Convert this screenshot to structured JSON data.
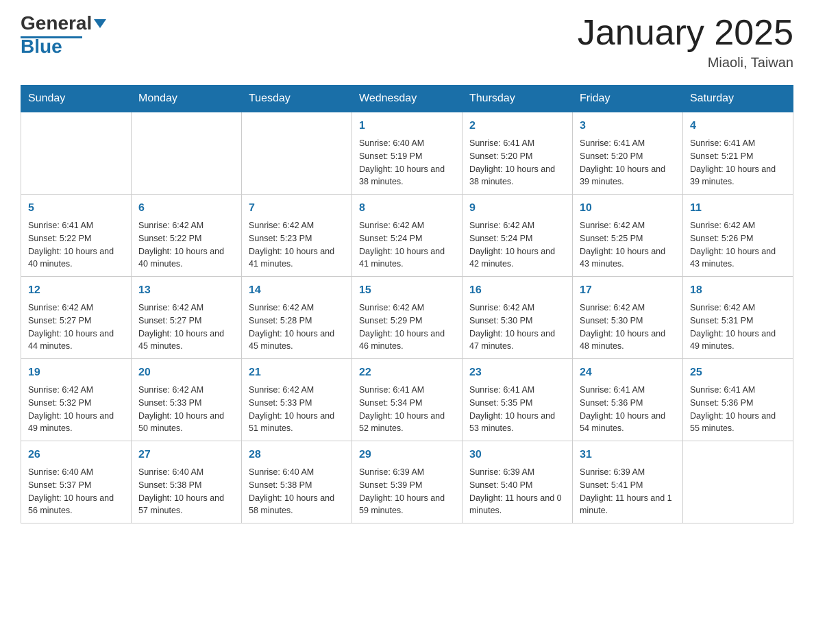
{
  "header": {
    "logo_general": "General",
    "logo_blue": "Blue",
    "month_title": "January 2025",
    "location": "Miaoli, Taiwan"
  },
  "days_of_week": [
    "Sunday",
    "Monday",
    "Tuesday",
    "Wednesday",
    "Thursday",
    "Friday",
    "Saturday"
  ],
  "weeks": [
    [
      {
        "day": "",
        "info": ""
      },
      {
        "day": "",
        "info": ""
      },
      {
        "day": "",
        "info": ""
      },
      {
        "day": "1",
        "info": "Sunrise: 6:40 AM\nSunset: 5:19 PM\nDaylight: 10 hours\nand 38 minutes."
      },
      {
        "day": "2",
        "info": "Sunrise: 6:41 AM\nSunset: 5:20 PM\nDaylight: 10 hours\nand 38 minutes."
      },
      {
        "day": "3",
        "info": "Sunrise: 6:41 AM\nSunset: 5:20 PM\nDaylight: 10 hours\nand 39 minutes."
      },
      {
        "day": "4",
        "info": "Sunrise: 6:41 AM\nSunset: 5:21 PM\nDaylight: 10 hours\nand 39 minutes."
      }
    ],
    [
      {
        "day": "5",
        "info": "Sunrise: 6:41 AM\nSunset: 5:22 PM\nDaylight: 10 hours\nand 40 minutes."
      },
      {
        "day": "6",
        "info": "Sunrise: 6:42 AM\nSunset: 5:22 PM\nDaylight: 10 hours\nand 40 minutes."
      },
      {
        "day": "7",
        "info": "Sunrise: 6:42 AM\nSunset: 5:23 PM\nDaylight: 10 hours\nand 41 minutes."
      },
      {
        "day": "8",
        "info": "Sunrise: 6:42 AM\nSunset: 5:24 PM\nDaylight: 10 hours\nand 41 minutes."
      },
      {
        "day": "9",
        "info": "Sunrise: 6:42 AM\nSunset: 5:24 PM\nDaylight: 10 hours\nand 42 minutes."
      },
      {
        "day": "10",
        "info": "Sunrise: 6:42 AM\nSunset: 5:25 PM\nDaylight: 10 hours\nand 43 minutes."
      },
      {
        "day": "11",
        "info": "Sunrise: 6:42 AM\nSunset: 5:26 PM\nDaylight: 10 hours\nand 43 minutes."
      }
    ],
    [
      {
        "day": "12",
        "info": "Sunrise: 6:42 AM\nSunset: 5:27 PM\nDaylight: 10 hours\nand 44 minutes."
      },
      {
        "day": "13",
        "info": "Sunrise: 6:42 AM\nSunset: 5:27 PM\nDaylight: 10 hours\nand 45 minutes."
      },
      {
        "day": "14",
        "info": "Sunrise: 6:42 AM\nSunset: 5:28 PM\nDaylight: 10 hours\nand 45 minutes."
      },
      {
        "day": "15",
        "info": "Sunrise: 6:42 AM\nSunset: 5:29 PM\nDaylight: 10 hours\nand 46 minutes."
      },
      {
        "day": "16",
        "info": "Sunrise: 6:42 AM\nSunset: 5:30 PM\nDaylight: 10 hours\nand 47 minutes."
      },
      {
        "day": "17",
        "info": "Sunrise: 6:42 AM\nSunset: 5:30 PM\nDaylight: 10 hours\nand 48 minutes."
      },
      {
        "day": "18",
        "info": "Sunrise: 6:42 AM\nSunset: 5:31 PM\nDaylight: 10 hours\nand 49 minutes."
      }
    ],
    [
      {
        "day": "19",
        "info": "Sunrise: 6:42 AM\nSunset: 5:32 PM\nDaylight: 10 hours\nand 49 minutes."
      },
      {
        "day": "20",
        "info": "Sunrise: 6:42 AM\nSunset: 5:33 PM\nDaylight: 10 hours\nand 50 minutes."
      },
      {
        "day": "21",
        "info": "Sunrise: 6:42 AM\nSunset: 5:33 PM\nDaylight: 10 hours\nand 51 minutes."
      },
      {
        "day": "22",
        "info": "Sunrise: 6:41 AM\nSunset: 5:34 PM\nDaylight: 10 hours\nand 52 minutes."
      },
      {
        "day": "23",
        "info": "Sunrise: 6:41 AM\nSunset: 5:35 PM\nDaylight: 10 hours\nand 53 minutes."
      },
      {
        "day": "24",
        "info": "Sunrise: 6:41 AM\nSunset: 5:36 PM\nDaylight: 10 hours\nand 54 minutes."
      },
      {
        "day": "25",
        "info": "Sunrise: 6:41 AM\nSunset: 5:36 PM\nDaylight: 10 hours\nand 55 minutes."
      }
    ],
    [
      {
        "day": "26",
        "info": "Sunrise: 6:40 AM\nSunset: 5:37 PM\nDaylight: 10 hours\nand 56 minutes."
      },
      {
        "day": "27",
        "info": "Sunrise: 6:40 AM\nSunset: 5:38 PM\nDaylight: 10 hours\nand 57 minutes."
      },
      {
        "day": "28",
        "info": "Sunrise: 6:40 AM\nSunset: 5:38 PM\nDaylight: 10 hours\nand 58 minutes."
      },
      {
        "day": "29",
        "info": "Sunrise: 6:39 AM\nSunset: 5:39 PM\nDaylight: 10 hours\nand 59 minutes."
      },
      {
        "day": "30",
        "info": "Sunrise: 6:39 AM\nSunset: 5:40 PM\nDaylight: 11 hours\nand 0 minutes."
      },
      {
        "day": "31",
        "info": "Sunrise: 6:39 AM\nSunset: 5:41 PM\nDaylight: 11 hours\nand 1 minute."
      },
      {
        "day": "",
        "info": ""
      }
    ]
  ]
}
